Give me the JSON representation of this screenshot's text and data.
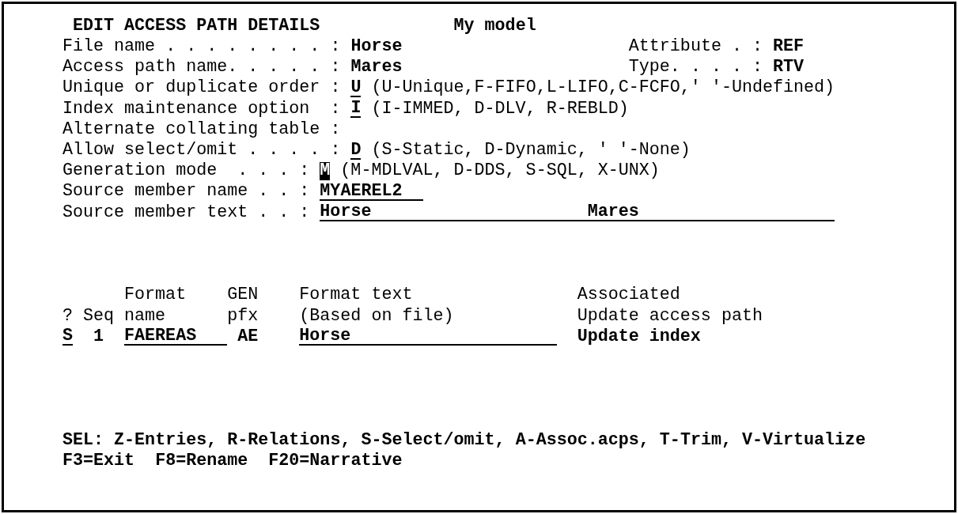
{
  "header": {
    "title": "EDIT ACCESS PATH DETAILS",
    "model": "My model"
  },
  "fields": [
    {
      "label": "File name . . . . . . . . :",
      "kind": "display",
      "value": "Horse",
      "side_field": {
        "label": "Attribute . :",
        "value": "REF"
      }
    },
    {
      "label": "Access path name. . . . . :",
      "kind": "display",
      "value": "Mares",
      "side_field": {
        "label": "Type. . . . :",
        "value": "RTV"
      }
    },
    {
      "label": "Unique or duplicate order :",
      "kind": "option",
      "value": "U",
      "cursor": false,
      "hint": "(U-Unique,F-FIFO,L-LIFO,C-FCFO,' '-Undefined)"
    },
    {
      "label": "Index maintenance option  :",
      "kind": "option",
      "value": "I",
      "cursor": false,
      "hint": "(I-IMMED, D-DLV, R-REBLD)"
    },
    {
      "label": "Alternate collating table :"
    },
    {
      "label": "Allow select/omit . . . . :",
      "kind": "option",
      "value": "D",
      "cursor": false,
      "hint": "(S-Static, D-Dynamic, ' '-None)"
    },
    {
      "label": "Generation mode  . . . :",
      "kind": "option",
      "value": "M",
      "cursor": true,
      "hint": "(M-MDLVAL, D-DDS, S-SQL, X-UNX)"
    },
    {
      "label": "Source member name . . :",
      "kind": "name",
      "value": "MYAEREL2",
      "cursor": false
    },
    {
      "label": "Source member text . . :",
      "kind": "text",
      "value": "Horse                     Mares",
      "cursor": false
    }
  ],
  "table": {
    "columns": [
      {
        "heading": [
          "?"
        ]
      },
      {
        "heading": [
          "Seq"
        ]
      },
      {
        "heading": [
          "Format",
          "name"
        ]
      },
      {
        "heading": [
          "GEN",
          "pfx"
        ]
      },
      {
        "heading": [
          "Format text",
          "(Based on file)"
        ]
      },
      {
        "heading": [
          "Associated",
          "Update access path"
        ]
      }
    ],
    "rows": [
      {
        "selection": "S",
        "seq": "1",
        "format_name": "FAEREAS",
        "gen_pfx": "AE",
        "format_text": "Horse",
        "associated": "Update index"
      }
    ]
  },
  "footer": {
    "selection_options": "SEL: Z-Entries, R-Relations, S-Select/omit, A-Assoc.acps, T-Trim, V-Virtualize",
    "function_keys": [
      "F3=Exit",
      "F8=Rename",
      "F20=Narrative"
    ]
  }
}
